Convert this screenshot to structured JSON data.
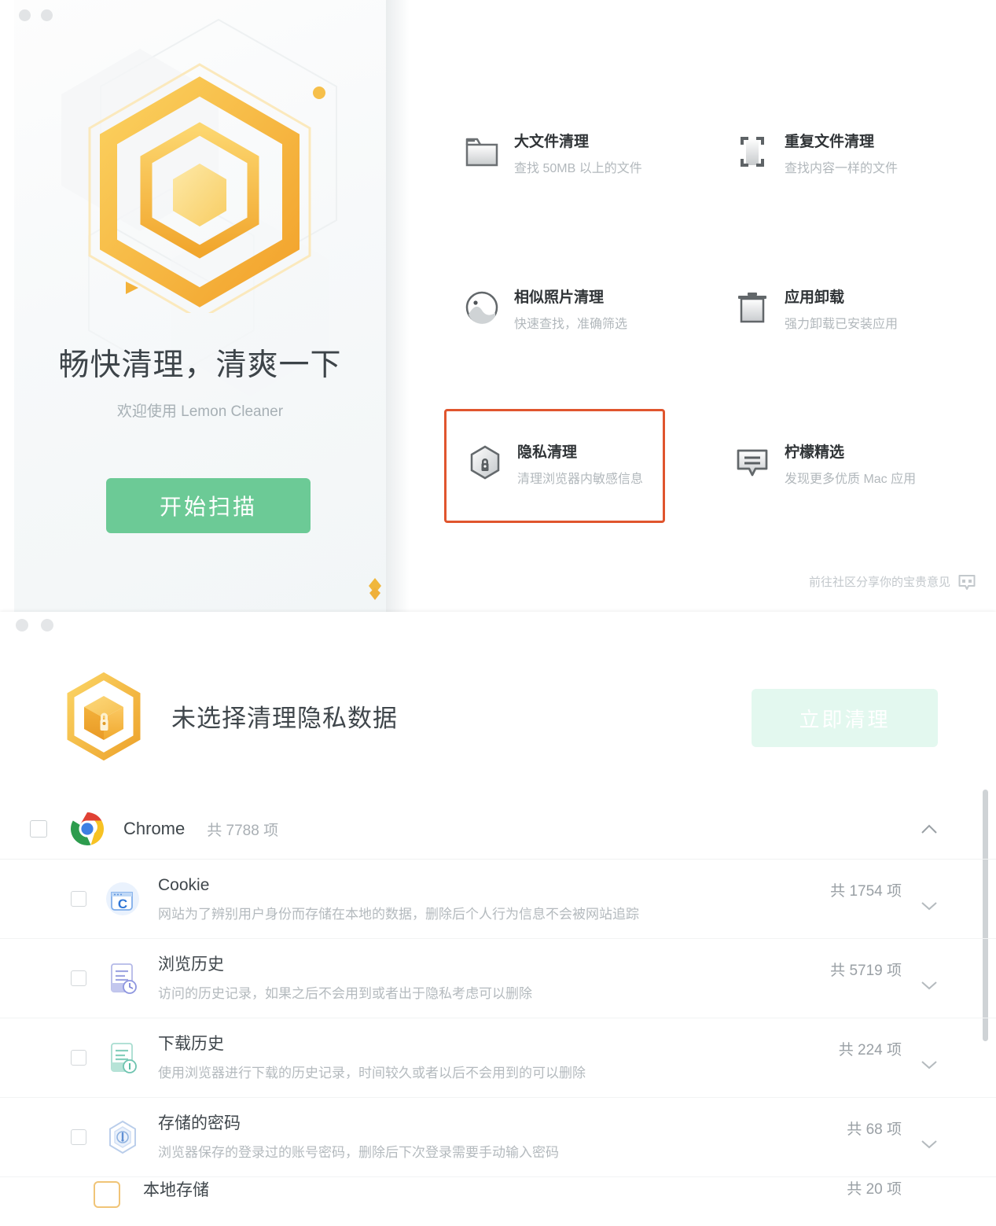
{
  "window1": {
    "traffic_lights": [
      "close",
      "minimize"
    ],
    "hero": {
      "title": "畅快清理，清爽一下",
      "welcome": "欢迎使用 Lemon Cleaner",
      "scan_button": "开始扫描",
      "logo_icon": "hexagon-logo",
      "diamond_icon": "diamond-icon"
    },
    "features": [
      {
        "title": "大文件清理",
        "desc": "查找 50MB 以上的文件",
        "icon": "folder-icon"
      },
      {
        "title": "重复文件清理",
        "desc": "查找内容一样的文件",
        "icon": "duplicate-frame-icon"
      },
      {
        "title": "相似照片清理",
        "desc": "快速查找，准确筛选",
        "icon": "photo-circle-icon"
      },
      {
        "title": "应用卸载",
        "desc": "强力卸载已安装应用",
        "icon": "trash-icon"
      },
      {
        "title": "隐私清理",
        "desc": "清理浏览器内敏感信息",
        "icon": "privacy-lock-hexagon-icon"
      },
      {
        "title": "柠檬精选",
        "desc": "发现更多优质 Mac 应用",
        "icon": "speech-bubble-icon"
      }
    ],
    "highlight": {
      "index": 4,
      "border_color": "#e0552e"
    },
    "community": {
      "text": "前往社区分享你的宝贵意见",
      "icon": "community-bubble-icon"
    }
  },
  "window2": {
    "traffic_lights": [
      "close",
      "minimize"
    ],
    "header": {
      "logo_icon": "privacy-hexagon-logo",
      "title": "未选择清理隐私数据",
      "clean_button": "立即清理",
      "clean_button_disabled": true
    },
    "app_group": {
      "name": "Chrome",
      "icon": "chrome-icon",
      "count": "共 7788 项",
      "checked": false,
      "expanded": true,
      "collapse_icon": "chevron-up-icon"
    },
    "items": [
      {
        "title": "Cookie",
        "desc": "网站为了辨别用户身份而存储在本地的数据，删除后个人行为信息不会被网站追踪",
        "count": "共 1754 项",
        "icon": "cookie-browser-icon",
        "checked": false,
        "expand_icon": "chevron-down-icon"
      },
      {
        "title": "浏览历史",
        "desc": "访问的历史记录，如果之后不会用到或者出于隐私考虑可以删除",
        "count": "共 5719 项",
        "icon": "history-doc-icon",
        "checked": false,
        "expand_icon": "chevron-down-icon"
      },
      {
        "title": "下载历史",
        "desc": "使用浏览器进行下载的历史记录，时间较久或者以后不会用到的可以删除",
        "count": "共 224 项",
        "icon": "download-doc-icon",
        "checked": false,
        "expand_icon": "chevron-down-icon"
      },
      {
        "title": "存储的密码",
        "desc": "浏览器保存的登录过的账号密码，删除后下次登录需要手动输入密码",
        "count": "共 68 项",
        "icon": "password-hexagon-icon",
        "checked": false,
        "expand_icon": "chevron-down-icon"
      }
    ],
    "partial_item": {
      "title": "本地存储",
      "count": "共 20 项",
      "icon": "local-storage-icon"
    }
  },
  "colors": {
    "accent_green": "#6cca96",
    "highlight_orange": "#e0552e",
    "logo_gold": "#f0ae33",
    "disabled_button": "#e3f8ef"
  }
}
